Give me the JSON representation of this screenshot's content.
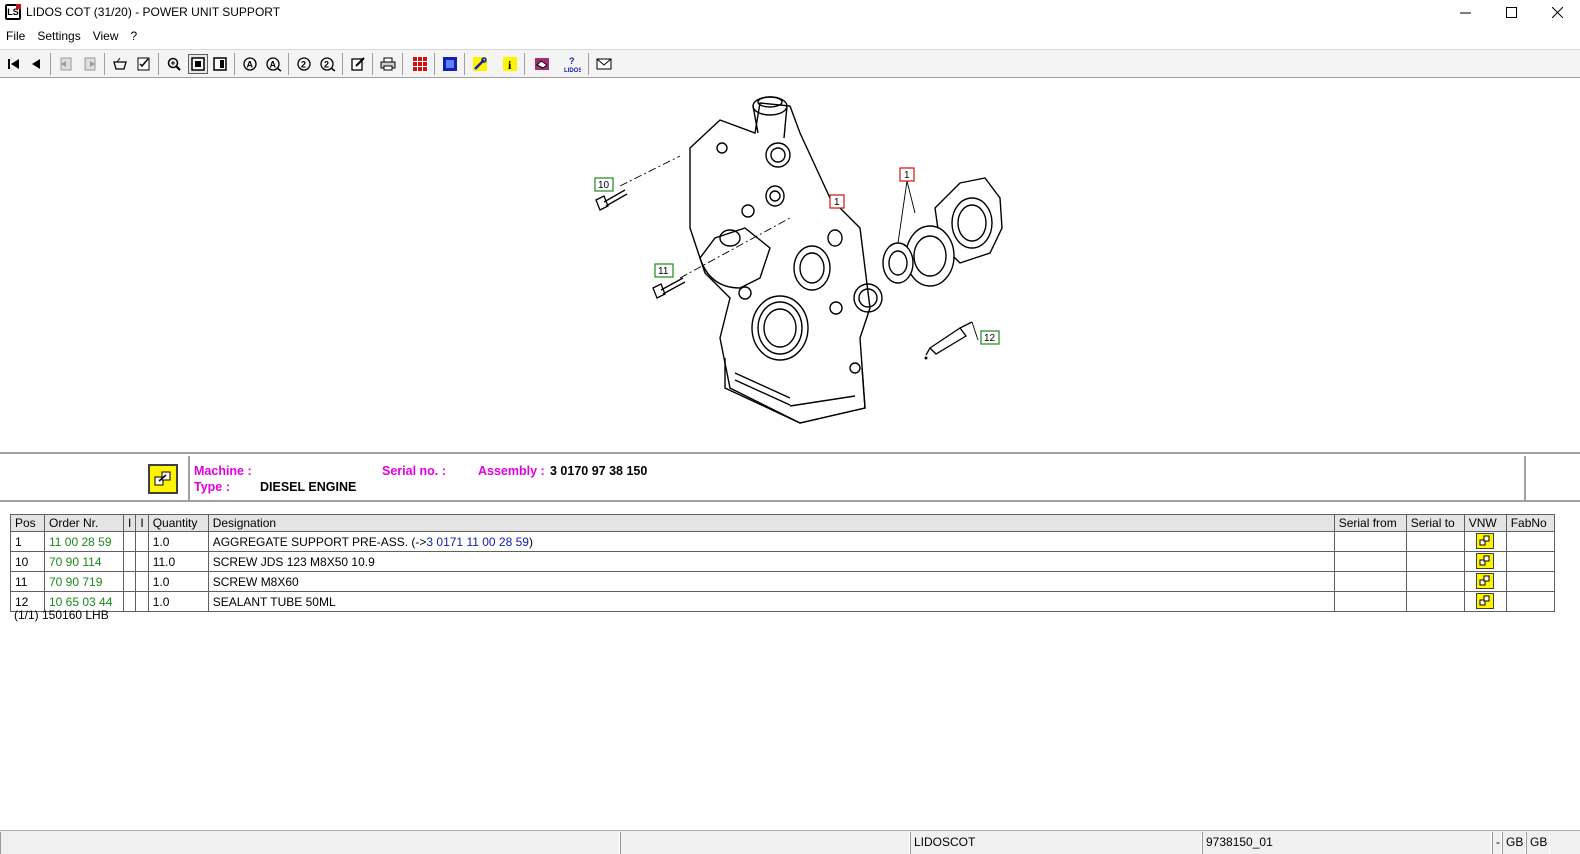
{
  "window": {
    "title": "LIDOS COT (31/20) - POWER UNIT SUPPORT",
    "app_icon": "LS"
  },
  "menu": {
    "items": [
      "File",
      "Settings",
      "View",
      "?"
    ]
  },
  "drawing": {
    "callouts": [
      "10",
      "1",
      "1",
      "11",
      "12"
    ]
  },
  "info": {
    "machine_label": "Machine :",
    "machine_value": "",
    "serial_label": "Serial no. :",
    "serial_value": "",
    "assembly_label": "Assembly :",
    "assembly_value": "3 0170 97 38 150",
    "type_label": "Type :",
    "type_value": "DIESEL ENGINE"
  },
  "table": {
    "headers": [
      "Pos",
      "Order Nr.",
      "I",
      "I",
      "Quantity",
      "Designation",
      "Serial from",
      "Serial to",
      "VNW",
      "FabNo"
    ],
    "rows": [
      {
        "pos": "1",
        "order": "11 00 28 59",
        "qty": "1.0",
        "designation": "AGGREGATE SUPPORT PRE-ASS. (->",
        "ref": "3 0171 11 00 28 59",
        "designation_end": ")"
      },
      {
        "pos": "10",
        "order": "70 90 114",
        "qty": "11.0",
        "designation": "SCREW JDS 123 M8X50 10.9",
        "ref": "",
        "designation_end": ""
      },
      {
        "pos": "11",
        "order": "70 90 719",
        "qty": "1.0",
        "designation": "SCREW M8X60",
        "ref": "",
        "designation_end": ""
      },
      {
        "pos": "12",
        "order": "10 65 03 44",
        "qty": "1.0",
        "designation": "SEALANT TUBE 50ML",
        "ref": "",
        "designation_end": ""
      }
    ],
    "caption": "(1/1) 150160 LHB"
  },
  "status": {
    "app": "LIDOSCOT",
    "doc": "9738150_01",
    "lang_prefix": "-",
    "lang1": "GB",
    "lang2": "GB"
  },
  "colors": {
    "label": "#e000e0",
    "order_link": "#1a8a1a",
    "ref_link": "#1020b0",
    "parts_button": "#fff400"
  }
}
